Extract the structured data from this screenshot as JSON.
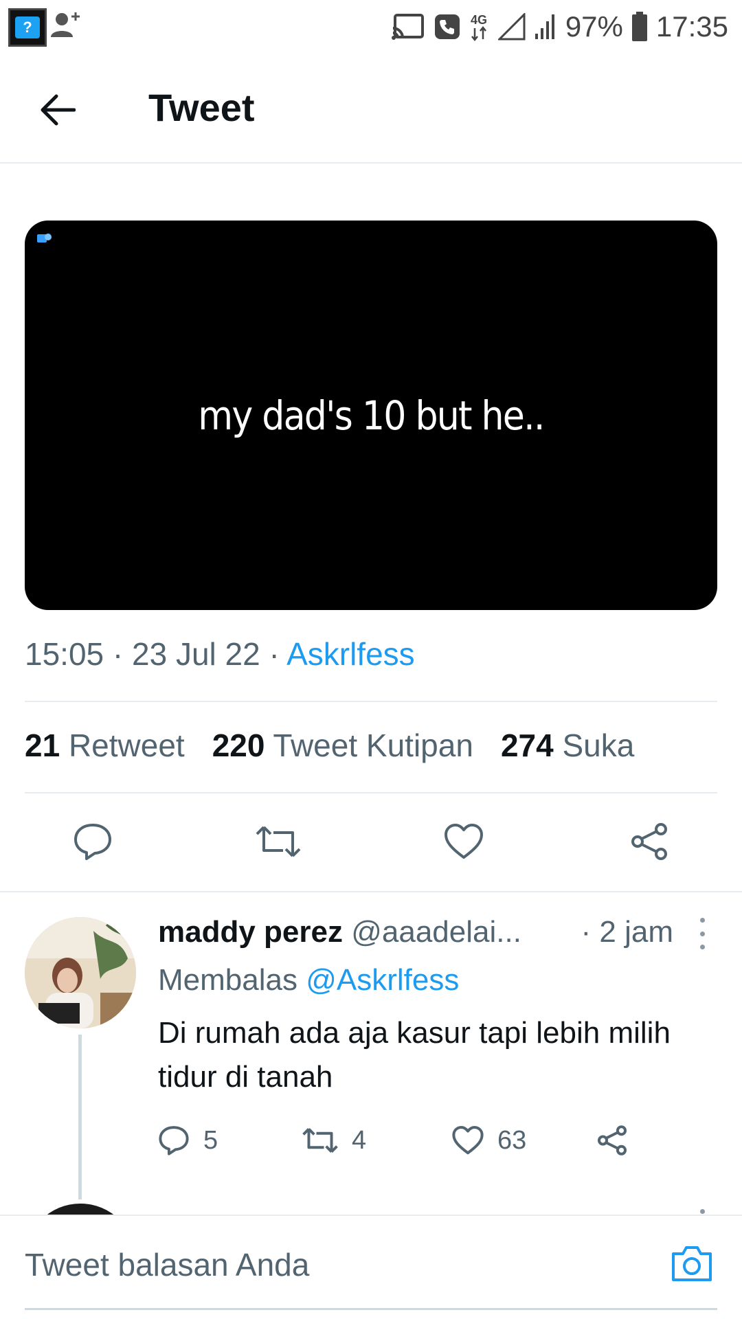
{
  "status_bar": {
    "app_icon": "twitter-app-icon",
    "battery": "97%",
    "time": "17:35",
    "network": "4G"
  },
  "header": {
    "title": "Tweet"
  },
  "media": {
    "caption": "my dad's 10 but he.."
  },
  "meta": {
    "time": "15:05",
    "date": "23 Jul 22",
    "source": "Askrlfess"
  },
  "stats": {
    "retweets_count": "21",
    "retweets_label": "Retweet",
    "quotes_count": "220",
    "quotes_label": "Tweet Kutipan",
    "likes_count": "274",
    "likes_label": "Suka"
  },
  "reply": {
    "name": "maddy perez",
    "handle": "@aaadelai...",
    "time": "· 2 jam",
    "replying_label": "Membalas",
    "replying_to": "@Askrlfess",
    "text": "Di rumah ada aja kasur tapi lebih milih tidur di tanah",
    "reply_count": "5",
    "retweet_count": "4",
    "like_count": "63"
  },
  "compose": {
    "placeholder": "Tweet balasan Anda"
  },
  "colors": {
    "accent": "#1d9bf0",
    "text_primary": "#0f1419",
    "text_secondary": "#536471",
    "divider": "#e6ecf0"
  }
}
